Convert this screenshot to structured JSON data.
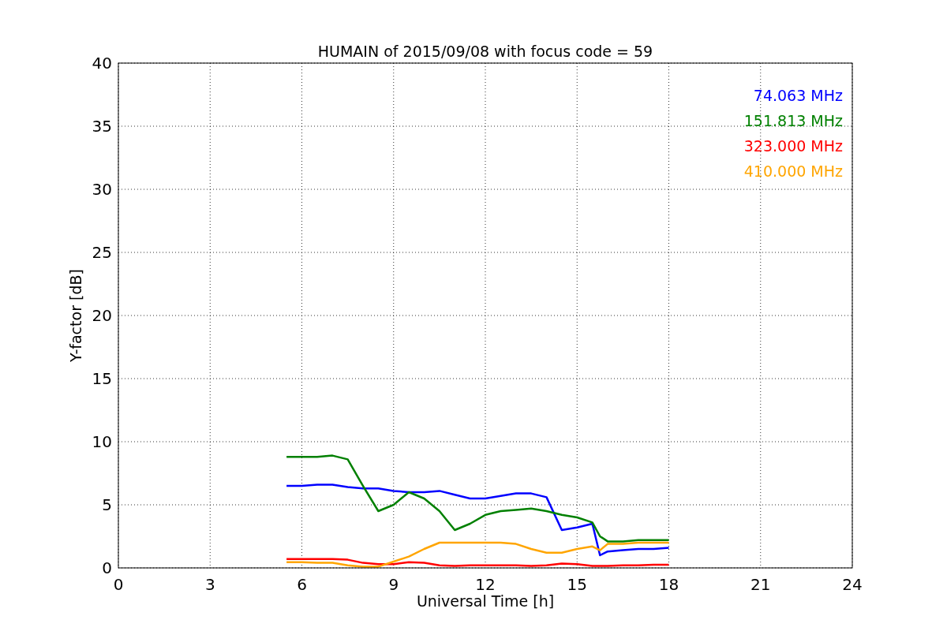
{
  "chart_data": {
    "type": "line",
    "title": "HUMAIN of 2015/09/08 with focus code = 59",
    "xlabel": "Universal Time [h]",
    "ylabel": "Y-factor [dB]",
    "x": [
      5.5,
      6,
      6.5,
      7,
      7.5,
      8,
      8.5,
      9,
      9.5,
      10,
      10.5,
      11,
      11.5,
      12,
      12.5,
      13,
      13.5,
      14,
      14.5,
      15,
      15.5,
      15.75,
      16,
      16.5,
      17,
      17.5,
      18
    ],
    "series": [
      {
        "name": "74.063 MHz",
        "color": "#0000ff",
        "values": [
          6.5,
          6.5,
          6.6,
          6.6,
          6.4,
          6.3,
          6.3,
          6.1,
          6.0,
          6.0,
          6.1,
          5.8,
          5.5,
          5.5,
          5.7,
          5.9,
          5.9,
          5.6,
          3.0,
          3.2,
          3.5,
          1.0,
          1.3,
          1.4,
          1.5,
          1.5,
          1.6
        ]
      },
      {
        "name": "151.813 MHz",
        "color": "#008000",
        "values": [
          8.8,
          8.8,
          8.8,
          8.9,
          8.6,
          6.5,
          4.5,
          5.0,
          6.0,
          5.5,
          4.5,
          3.0,
          3.5,
          4.2,
          4.5,
          4.6,
          4.7,
          4.5,
          4.2,
          4.0,
          3.6,
          2.5,
          2.1,
          2.1,
          2.2,
          2.2,
          2.2
        ]
      },
      {
        "name": "323.000 MHz",
        "color": "#ff0000",
        "values": [
          0.7,
          0.7,
          0.7,
          0.7,
          0.65,
          0.4,
          0.3,
          0.3,
          0.45,
          0.4,
          0.2,
          0.15,
          0.2,
          0.2,
          0.2,
          0.2,
          0.15,
          0.2,
          0.35,
          0.3,
          0.15,
          0.15,
          0.15,
          0.2,
          0.2,
          0.25,
          0.25
        ]
      },
      {
        "name": "410.000 MHz",
        "color": "#ffa500",
        "values": [
          0.45,
          0.45,
          0.4,
          0.4,
          0.2,
          0.1,
          0.1,
          0.5,
          0.9,
          1.5,
          2.0,
          2.0,
          2.0,
          2.0,
          2.0,
          1.9,
          1.5,
          1.2,
          1.2,
          1.5,
          1.7,
          1.4,
          1.9,
          1.9,
          2.0,
          2.0,
          2.0
        ]
      }
    ],
    "grid": true,
    "xlim": [
      0,
      24
    ],
    "ylim": [
      0,
      40
    ],
    "xticks": [
      0,
      3,
      6,
      9,
      12,
      15,
      18,
      21,
      24
    ],
    "yticks": [
      0,
      5,
      10,
      15,
      20,
      25,
      30,
      35,
      40
    ]
  }
}
